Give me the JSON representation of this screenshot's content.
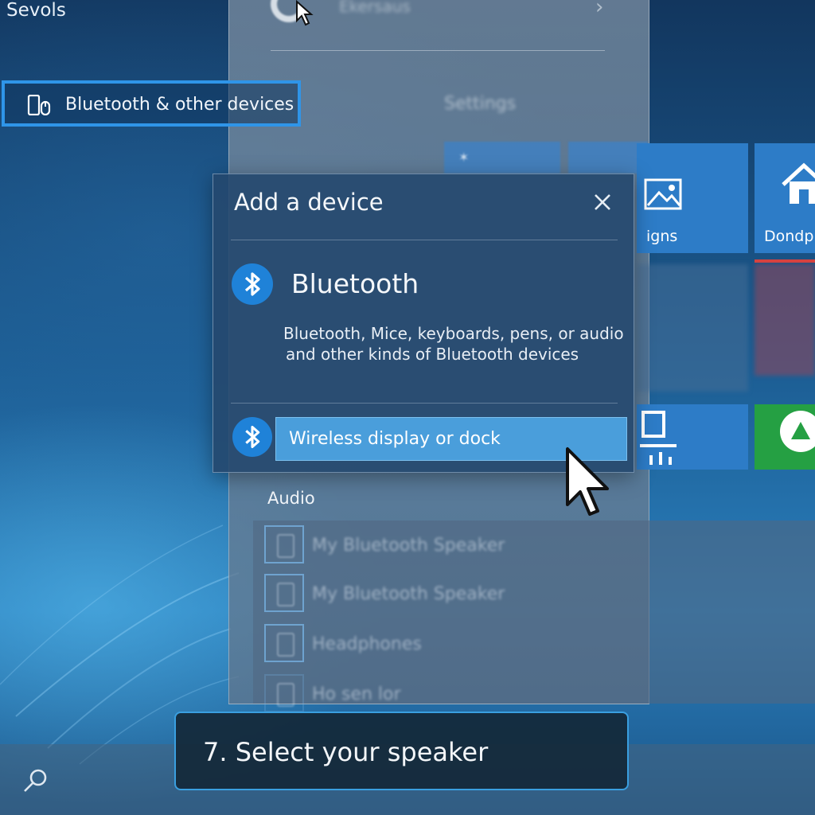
{
  "desktop": {
    "title": "Sevols"
  },
  "sidebar_highlight": {
    "label": "Bluetooth & other devices",
    "icon": "phone-mouse-icon",
    "accent": "#2f95e8"
  },
  "settings_panel": {
    "header_text": "Ekersaus",
    "section": "Settings"
  },
  "tiles": [
    {
      "label": "igns",
      "icon": "image-icon"
    },
    {
      "label": "Dondp",
      "icon": "home-icon"
    }
  ],
  "dialog": {
    "title": "Add a device",
    "close_icon": "close-icon",
    "option_bluetooth": {
      "title": "Bluetooth",
      "desc_line1": "Bluetooth, Mice, keyboards, pens, or audio",
      "desc_line2": "and other kinds of Bluetooth devices",
      "icon": "bluetooth-icon"
    },
    "option_wireless": {
      "label": "Wireless display or dock",
      "icon": "bluetooth-icon"
    },
    "accent": "#1f82d8"
  },
  "audio": {
    "heading": "Audio",
    "devices": [
      {
        "name": "My Bluetooth Speaker"
      },
      {
        "name": "My Bluetooth Speaker"
      },
      {
        "name": "Headphones"
      },
      {
        "name": "Ho sen lor"
      }
    ]
  },
  "caption": {
    "text": "7. Select your speaker",
    "border": "#3a9fe0"
  }
}
